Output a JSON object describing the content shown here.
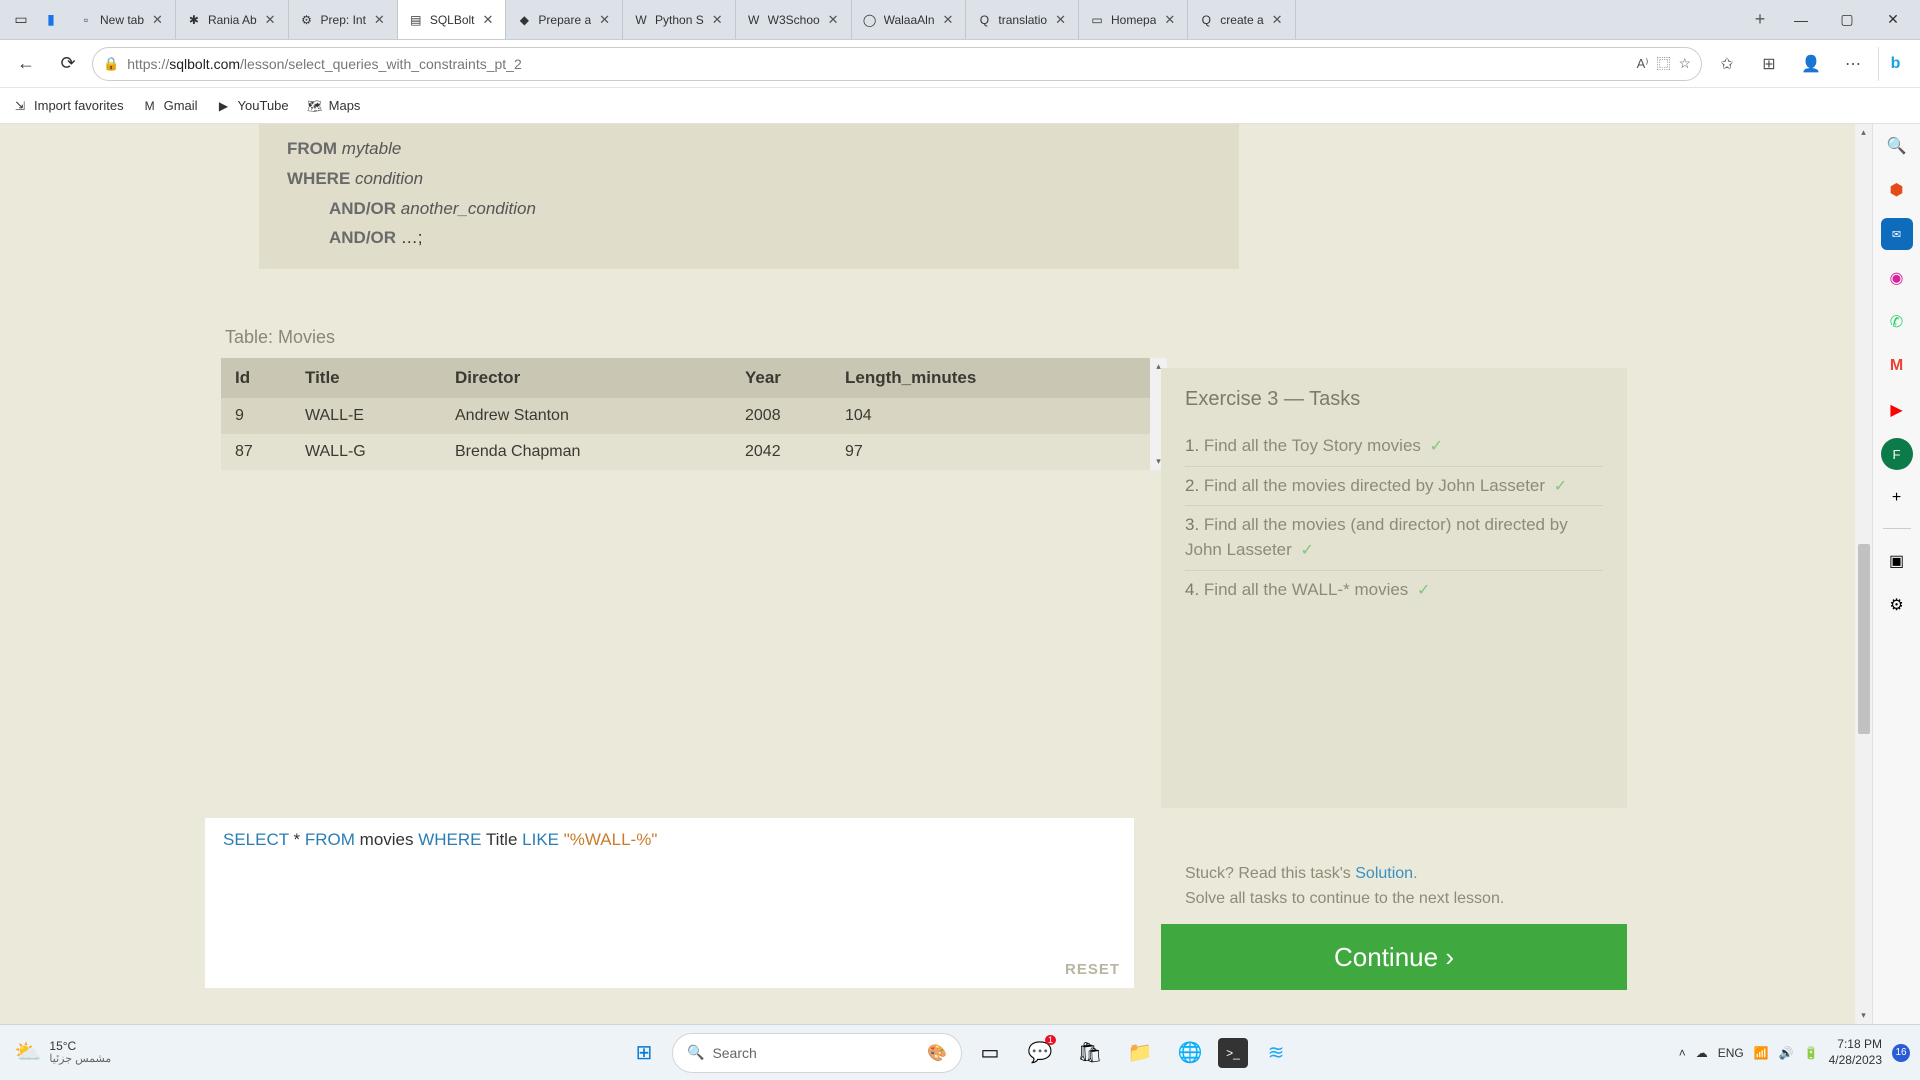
{
  "browser": {
    "tabs": [
      {
        "label": "New tab",
        "favicon": "▫"
      },
      {
        "label": "Rania Ab",
        "favicon": "✱"
      },
      {
        "label": "Prep: Int",
        "favicon": "⚙"
      },
      {
        "label": "SQLBolt",
        "favicon": "▤",
        "active": true
      },
      {
        "label": "Prepare a",
        "favicon": "◆"
      },
      {
        "label": "Python S",
        "favicon": "W"
      },
      {
        "label": "W3Schoo",
        "favicon": "W"
      },
      {
        "label": "WalaaAln",
        "favicon": "◯"
      },
      {
        "label": "translatio",
        "favicon": "Q"
      },
      {
        "label": "Homepa",
        "favicon": "▭"
      },
      {
        "label": "create a",
        "favicon": "Q"
      }
    ],
    "url_prefix": "https://",
    "url_host": "sqlbolt.com",
    "url_path": "/lesson/select_queries_with_constraints_pt_2",
    "favorites": [
      {
        "icon": "⇲",
        "label": "Import favorites"
      },
      {
        "icon": "M",
        "label": "Gmail"
      },
      {
        "icon": "▶",
        "label": "YouTube"
      },
      {
        "icon": "🗺",
        "label": "Maps"
      }
    ]
  },
  "page": {
    "hint_lines": {
      "l1a": "FROM ",
      "l1b": "mytable",
      "l2a": "WHERE ",
      "l2b": "condition",
      "l3a": "AND/OR ",
      "l3b": "another_condition",
      "l4a": "AND/OR ",
      "l4b": "…;"
    },
    "table_label": "Table: Movies",
    "columns": [
      "Id",
      "Title",
      "Director",
      "Year",
      "Length_minutes"
    ],
    "rows": [
      {
        "Id": "9",
        "Title": "WALL-E",
        "Director": "Andrew Stanton",
        "Year": "2008",
        "Length_minutes": "104"
      },
      {
        "Id": "87",
        "Title": "WALL-G",
        "Director": "Brenda Chapman",
        "Year": "2042",
        "Length_minutes": "97"
      }
    ],
    "tasks_title": "Exercise 3 — Tasks",
    "tasks": [
      {
        "n": "1.",
        "text": "Find all the Toy Story movies",
        "done": true
      },
      {
        "n": "2.",
        "text": "Find all the movies directed by John Lasseter",
        "done": true
      },
      {
        "n": "3.",
        "text": "Find all the movies (and director) not directed by John Lasseter",
        "done": true
      },
      {
        "n": "4.",
        "text": "Find all the WALL-* movies",
        "done": true
      }
    ],
    "editor": {
      "kw1": "SELECT",
      "star": " * ",
      "kw2": "FROM",
      "tbl": " movies ",
      "kw3": "WHERE",
      "sp": "  Title ",
      "kw4": "LIKE",
      "q": " ",
      "str": "\"%WALL-%\""
    },
    "reset": "RESET",
    "stuck_a": "Stuck? Read this task's ",
    "stuck_link": "Solution",
    "stuck_b": ".",
    "solve": "Solve all tasks to continue to the next lesson.",
    "continue": "Continue ›"
  },
  "taskbar": {
    "temp": "15°C",
    "desc": "مشمس جزئيا",
    "search": "Search",
    "lang": "ENG",
    "time": "7:18 PM",
    "date": "4/28/2023",
    "badge": "16"
  }
}
